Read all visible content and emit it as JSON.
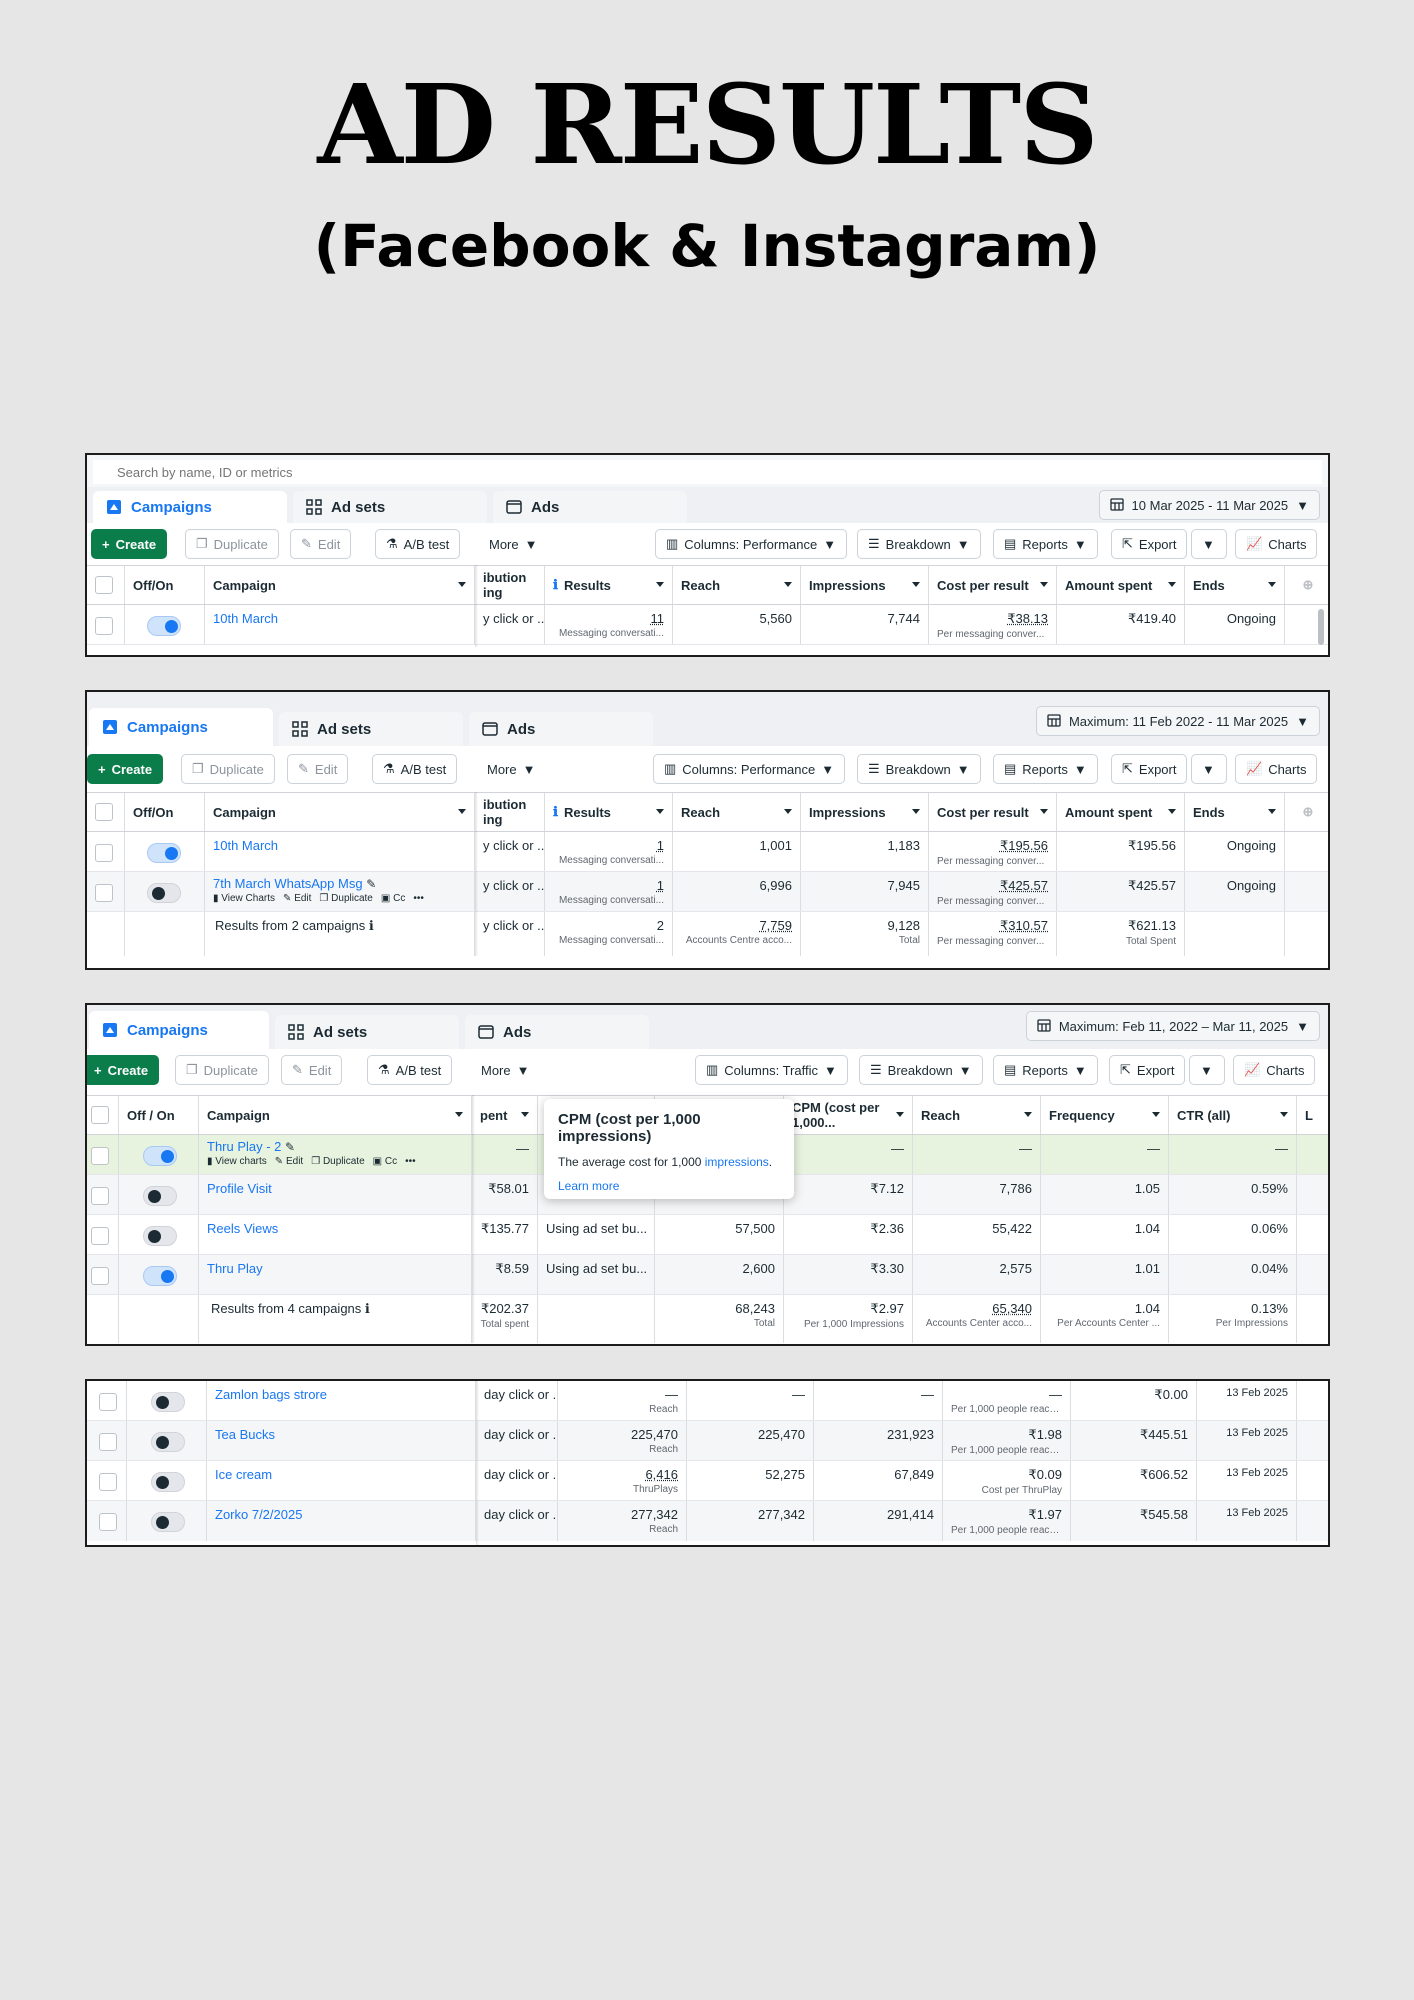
{
  "page": {
    "title": "AD RESULTS",
    "subtitle": "(Facebook & Instagram)"
  },
  "colors": {
    "accent": "#1877f2",
    "create": "#0a7d4a",
    "highlight_row": "#e8f3df"
  },
  "icons": [
    "campaigns-icon",
    "adsets-icon",
    "ads-icon",
    "calendar-icon",
    "columns-icon",
    "breakdown-icon",
    "reports-icon",
    "export-icon",
    "charts-icon",
    "info-icon",
    "pencil-icon"
  ],
  "common": {
    "tabs": {
      "campaigns": "Campaigns",
      "adsets": "Ad sets",
      "ads": "Ads"
    },
    "toolbar": {
      "create": "Create",
      "duplicate": "Duplicate",
      "edit": "Edit",
      "abtest": "A/B test",
      "more": "More",
      "breakdown": "Breakdown",
      "reports": "Reports",
      "export": "Export",
      "charts": "Charts"
    },
    "row_actions": {
      "view_charts": "View Charts",
      "view_charts_lc": "View charts",
      "edit": "Edit",
      "duplicate": "Duplicate",
      "cc": "Cc"
    }
  },
  "panel1": {
    "search_placeholder": "Search by name, ID or metrics",
    "date_range": "10 Mar 2025 - 11 Mar 2025",
    "columns": "Columns: Performance",
    "headers": {
      "offon": "Off/On",
      "campaign": "Campaign",
      "attribution": "ibution\ning",
      "results": "Results",
      "reach": "Reach",
      "impressions": "Impressions",
      "cpr": "Cost per result",
      "spent": "Amount spent",
      "ends": "Ends"
    },
    "rows": [
      {
        "name": "10th March",
        "attribution": "y click or ...",
        "results": "11",
        "results_sub": "Messaging conversati...",
        "reach": "5,560",
        "impressions": "7,744",
        "cpr": "₹38.13",
        "cpr_sub": "Per messaging conver...",
        "spent": "₹419.40",
        "ends": "Ongoing"
      }
    ]
  },
  "panel2": {
    "date_range": "Maximum: 11 Feb 2022 - 11 Mar 2025",
    "columns": "Columns: Performance",
    "headers": {
      "offon": "Off/On",
      "campaign": "Campaign",
      "attribution": "ibution\ning",
      "results": "Results",
      "reach": "Reach",
      "impressions": "Impressions",
      "cpr": "Cost per result",
      "spent": "Amount spent",
      "ends": "Ends"
    },
    "rows": [
      {
        "name": "10th March",
        "attribution": "y click or ...",
        "results": "1",
        "results_sub": "Messaging conversati...",
        "reach": "1,001",
        "impressions": "1,183",
        "cpr": "₹195.56",
        "cpr_sub": "Per messaging conver...",
        "spent": "₹195.56",
        "ends": "Ongoing"
      },
      {
        "name": "7th March WhatsApp Msg",
        "attribution": "y click or ...",
        "results": "1",
        "results_sub": "Messaging conversati...",
        "reach": "6,996",
        "impressions": "7,945",
        "cpr": "₹425.57",
        "cpr_sub": "Per messaging conver...",
        "spent": "₹425.57",
        "ends": "Ongoing"
      }
    ],
    "summary": {
      "label": "Results from 2 campaigns",
      "attribution": "y click or ...",
      "results": "2",
      "results_sub": "Messaging conversati...",
      "reach": "7,759",
      "reach_sub": "Accounts Centre acco...",
      "impressions": "9,128",
      "impressions_sub": "Total",
      "cpr": "₹310.57",
      "cpr_sub": "Per messaging conver...",
      "spent": "₹621.13",
      "spent_sub": "Total Spent"
    }
  },
  "panel3": {
    "date_range": "Maximum: Feb 11, 2022 – Mar 11, 2025",
    "columns": "Columns: Traffic",
    "headers": {
      "offon": "Off / On",
      "campaign": "Campaign",
      "spent": "pent",
      "cpm": "CPM (cost per 1,000...",
      "reach": "Reach",
      "frequency": "Frequency",
      "ctr": "CTR (all)",
      "next": "L"
    },
    "tooltip": {
      "title": "CPM (cost per 1,000 impressions)",
      "body_prefix": "The average cost for 1,000 ",
      "body_link": "impressions",
      "body_suffix": ".",
      "learn_more": "Learn more"
    },
    "rows": [
      {
        "name": "Thru Play - 2",
        "spent": "—",
        "bid": "",
        "impr": "",
        "cpm": "—",
        "reach": "—",
        "frequency": "—",
        "ctr": "—"
      },
      {
        "name": "Profile Visit",
        "spent": "₹58.01",
        "bid": "",
        "impr": "",
        "cpm": "₹7.12",
        "reach": "7,786",
        "frequency": "1.05",
        "ctr": "0.59%"
      },
      {
        "name": "Reels Views",
        "spent": "₹135.77",
        "bid": "Using ad set bu...",
        "impr": "57,500",
        "cpm": "₹2.36",
        "reach": "55,422",
        "frequency": "1.04",
        "ctr": "0.06%"
      },
      {
        "name": "Thru Play",
        "spent": "₹8.59",
        "bid": "Using ad set bu...",
        "impr": "2,600",
        "cpm": "₹3.30",
        "reach": "2,575",
        "frequency": "1.01",
        "ctr": "0.04%"
      }
    ],
    "summary": {
      "label": "Results from 4 campaigns",
      "spent": "₹202.37",
      "spent_sub": "Total spent",
      "impr": "68,243",
      "impr_sub": "Total",
      "cpm": "₹2.97",
      "cpm_sub": "Per 1,000 Impressions",
      "reach": "65,340",
      "reach_sub": "Accounts Center acco...",
      "frequency": "1.04",
      "frequency_sub": "Per Accounts Center ...",
      "ctr": "0.13%",
      "ctr_sub": "Per Impressions"
    }
  },
  "panel4": {
    "rows": [
      {
        "name": "Zamlon bags strore",
        "attribution": "day click or ...",
        "results": "—",
        "results_sub": "Reach",
        "reach": "—",
        "impressions": "—",
        "cpr": "—",
        "cpr_sub": "Per 1,000 people reach...",
        "spent": "₹0.00",
        "ends": "13 Feb 2025"
      },
      {
        "name": "Tea Bucks",
        "attribution": "day click or ...",
        "results": "225,470",
        "results_sub": "Reach",
        "reach": "225,470",
        "impressions": "231,923",
        "cpr": "₹1.98",
        "cpr_sub": "Per 1,000 people reach...",
        "spent": "₹445.51",
        "ends": "13 Feb 2025"
      },
      {
        "name": "Ice cream",
        "attribution": "day click or ...",
        "results": "6,416",
        "results_sub": "ThruPlays",
        "reach": "52,275",
        "impressions": "67,849",
        "cpr": "₹0.09",
        "cpr_sub": "Cost per ThruPlay",
        "spent": "₹606.52",
        "ends": "13 Feb 2025"
      },
      {
        "name": "Zorko 7/2/2025",
        "attribution": "day click or ...",
        "results": "277,342",
        "results_sub": "Reach",
        "reach": "277,342",
        "impressions": "291,414",
        "cpr": "₹1.97",
        "cpr_sub": "Per 1,000 people reach...",
        "spent": "₹545.58",
        "ends": "13 Feb 2025"
      }
    ]
  }
}
